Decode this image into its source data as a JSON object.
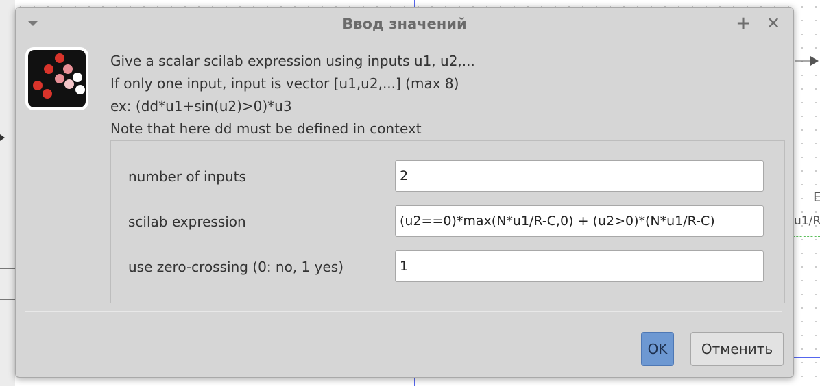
{
  "window": {
    "title": "Ввод значений",
    "maximize_glyph": "+",
    "close_glyph": "✕"
  },
  "icons": {
    "window_menu": "chevron-down-icon",
    "maximize": "plus-icon",
    "close": "close-icon",
    "app": "scilab-dots-icon"
  },
  "message": {
    "lines": [
      "Give a scalar scilab expression using inputs u1, u2,...",
      "If only one input, input is vector [u1,u2,...] (max 8)",
      "ex: (dd*u1+sin(u2)>0)*u3",
      "Note that here dd must be defined in context"
    ]
  },
  "form": {
    "fields": [
      {
        "label": "number of inputs",
        "value": "2"
      },
      {
        "label": "scilab expression",
        "value": "(u2==0)*max(N*u1/R-C,0) + (u2>0)*(N*u1/R-C)"
      },
      {
        "label": "use zero-crossing (0: no, 1 yes)",
        "value": "1"
      }
    ]
  },
  "buttons": {
    "ok": "OK",
    "cancel": "Отменить"
  },
  "background": {
    "block_label_top": "E",
    "block_label_bottom": "u1/R"
  },
  "colors": {
    "dialog_bg": "#d6d6d6",
    "ok_button": "#6d98d2",
    "input_bg": "#ffffff",
    "selection_blue": "#5566ee",
    "block_dash_green": "#5bbf5b"
  }
}
